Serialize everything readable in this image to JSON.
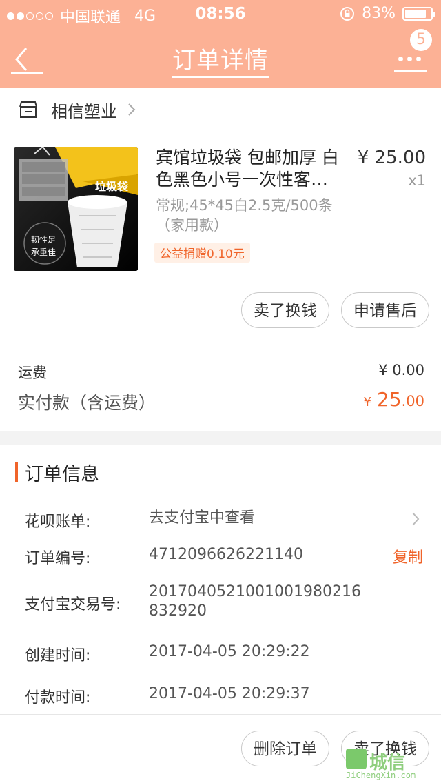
{
  "status_bar": {
    "carrier": "中国联通",
    "network": "4G",
    "time": "08:56",
    "battery": "83%",
    "battery_level": 0.83,
    "signal_bars_on": 2,
    "signal_bars_total": 5
  },
  "nav": {
    "title": "订单详情",
    "badge": "5"
  },
  "shop": {
    "name": "相信塑业"
  },
  "product": {
    "title": "宾馆垃圾袋 包邮加厚 白色黑色小号一次性客…",
    "price": "¥ 25.00",
    "qty": "x1",
    "sku": "常规;45*45白2.5克/500条（家用款）",
    "tag": "公益捐赠0.10元",
    "image": {
      "label": "垃圾袋",
      "badge_line1": "韧性足",
      "badge_line2": "承重佳"
    }
  },
  "actions": {
    "sell": "卖了换钱",
    "after_sale": "申请售后"
  },
  "summary": {
    "freight_label": "运费",
    "freight_value": "¥ 0.00",
    "paid_label": "实付款（含运费）",
    "paid_currency": "¥",
    "paid_int": "25",
    "paid_dec": ".00"
  },
  "order_info": {
    "heading": "订单信息",
    "huabei_label": "花呗账单:",
    "huabei_value": "去支付宝中查看",
    "order_no_label": "订单编号:",
    "order_no": "4712096626221140",
    "copy": "复制",
    "alipay_label": "支付宝交易号:",
    "alipay_line1": "201704052100100198021​6",
    "alipay_line2": "832920",
    "created_label": "创建时间:",
    "created": "2017-04-05 20:29:22",
    "paid_time_label": "付款时间:",
    "paid_time": "2017-04-05 20:29:37"
  },
  "bottom": {
    "delete": "删除订单",
    "sell": "卖了换钱"
  },
  "watermark": {
    "cn": "城信",
    "en": "JiChengXin.com"
  },
  "colors": {
    "header": "#fcb195",
    "accent": "#f0642a"
  }
}
